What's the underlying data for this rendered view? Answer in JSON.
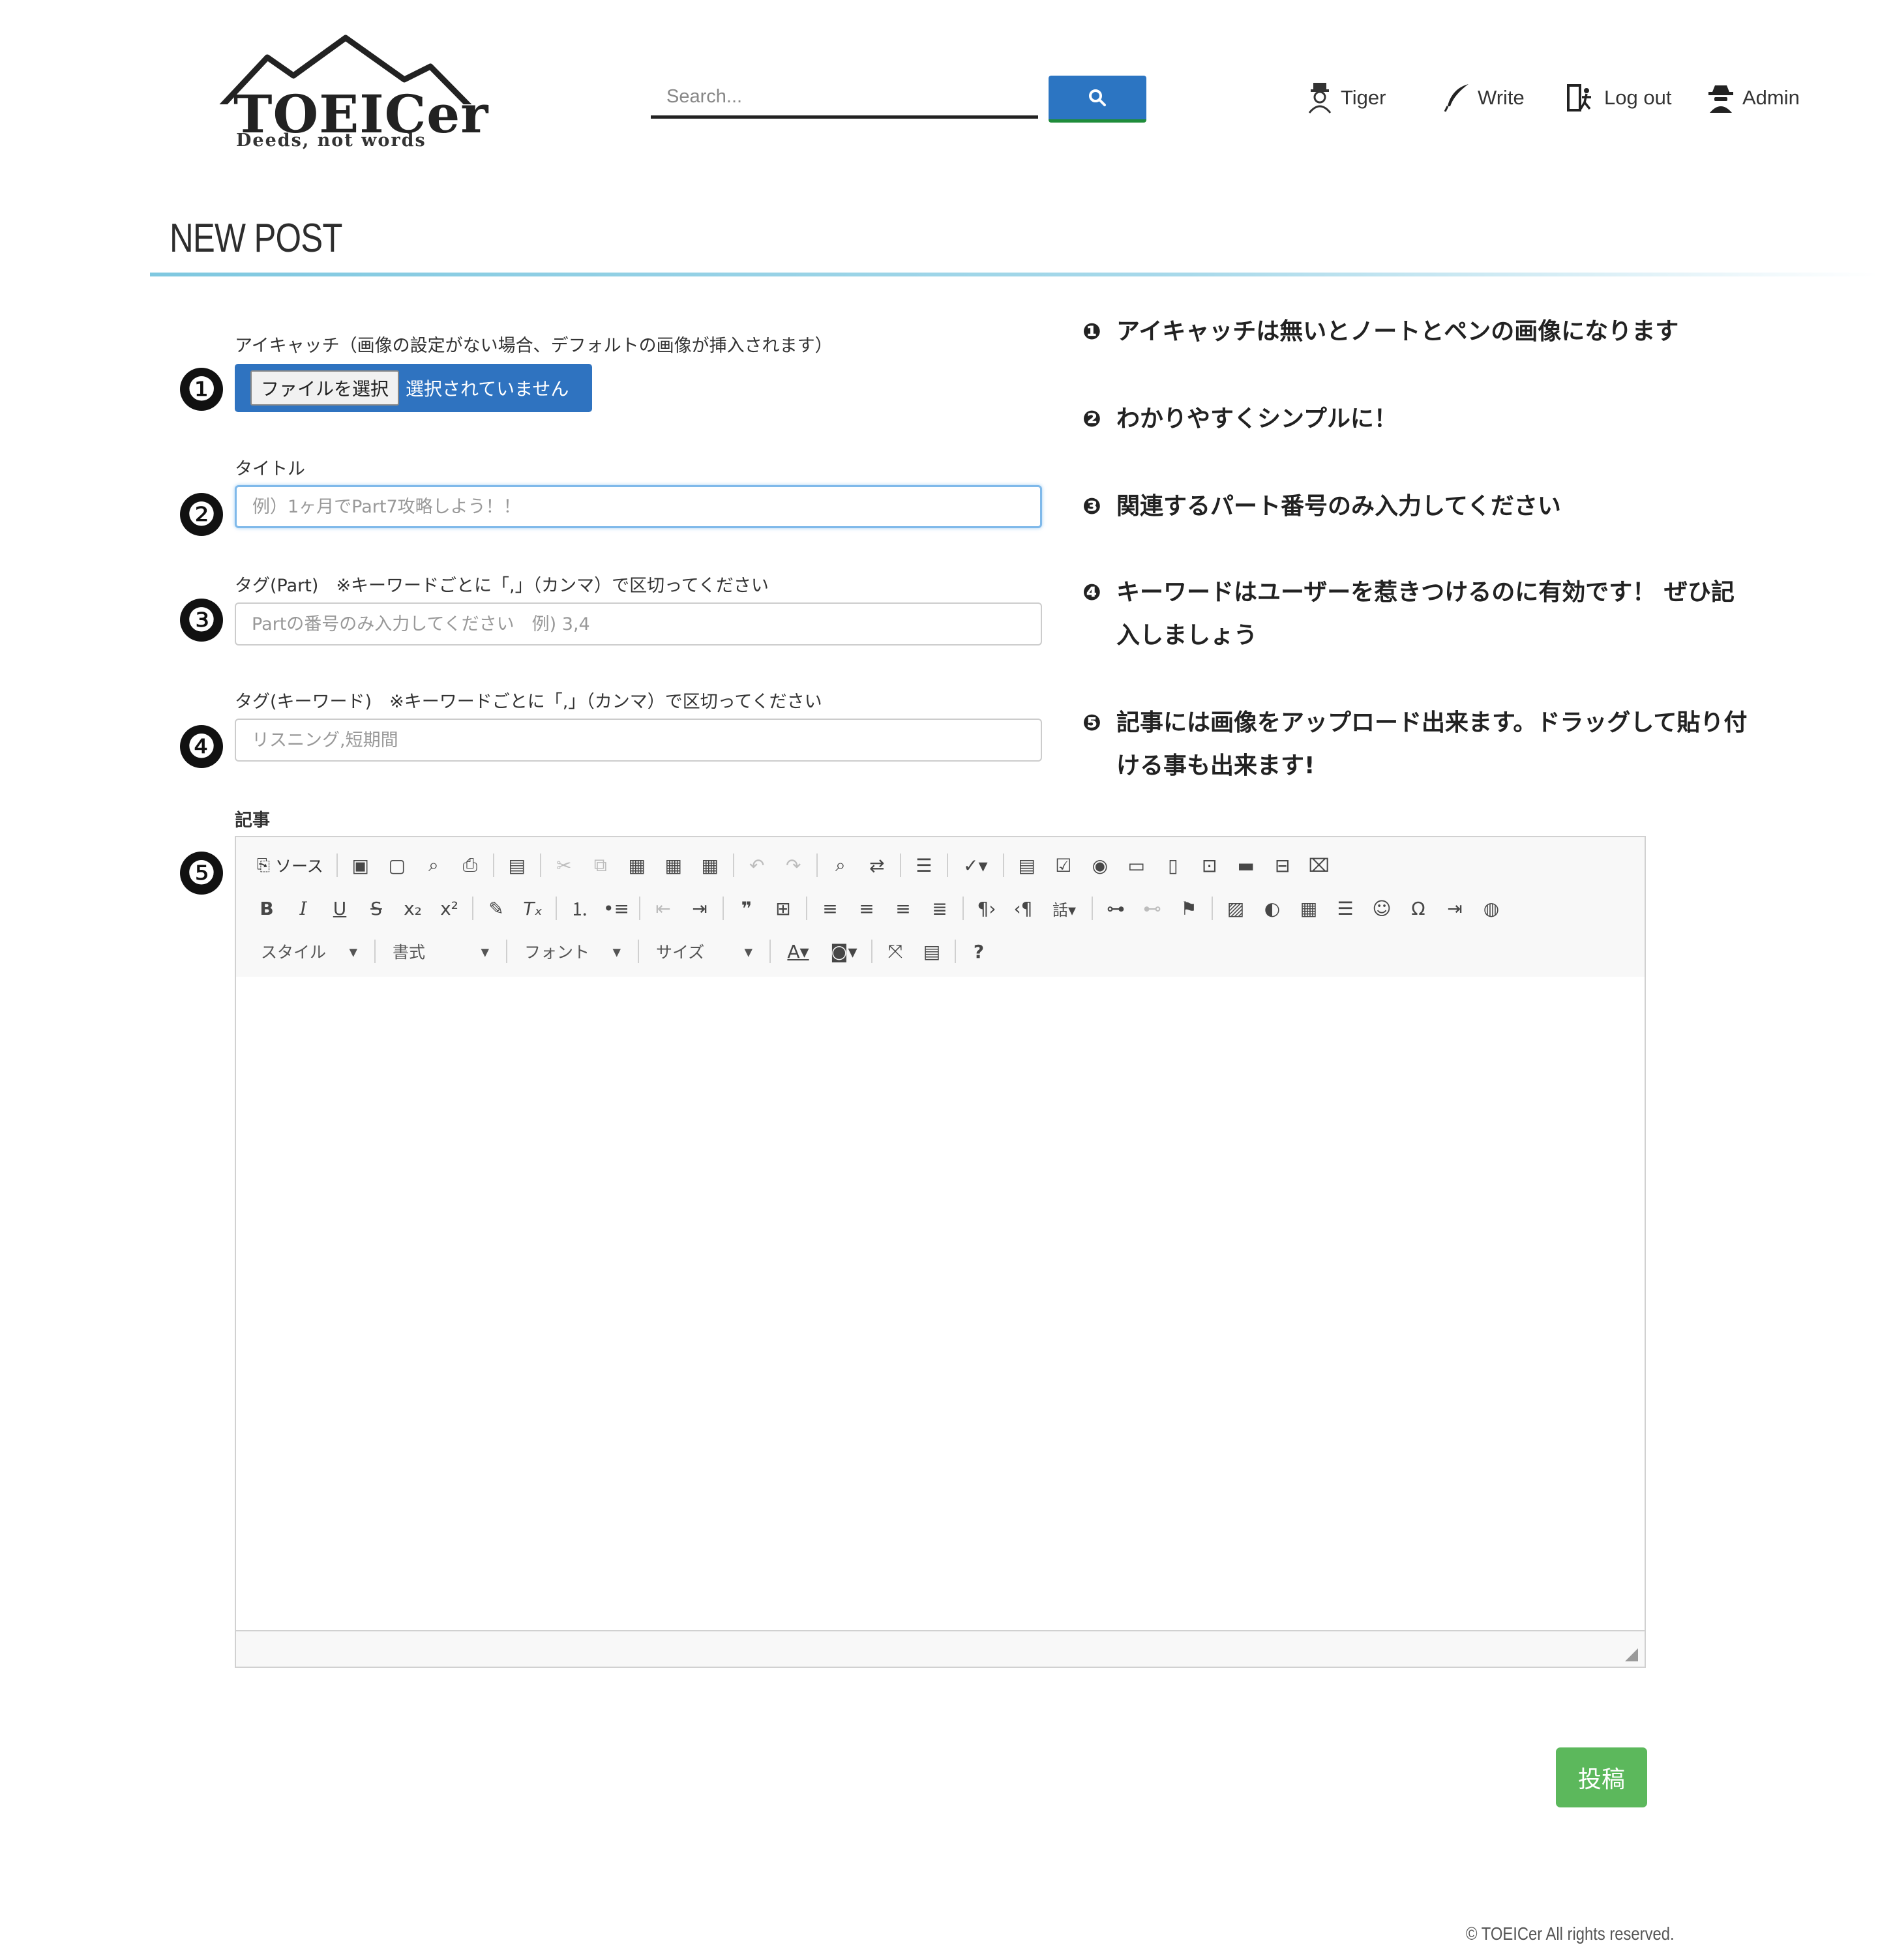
{
  "header": {
    "logo": {
      "name": "TOEICer",
      "tagline": "Deeds, not words"
    },
    "search": {
      "placeholder": "Search..."
    },
    "nav": [
      {
        "label": "Tiger",
        "icon": "user-avatar-icon"
      },
      {
        "label": "Write",
        "icon": "quill-pen-icon"
      },
      {
        "label": "Log out",
        "icon": "logout-door-icon"
      },
      {
        "label": "Admin",
        "icon": "admin-spy-icon"
      }
    ]
  },
  "page": {
    "title": "NEW POST"
  },
  "form": {
    "eyecatch": {
      "number": "❶",
      "label": "アイキャッチ（画像の設定がない場合、デフォルトの画像が挿入されます）",
      "button": "ファイルを選択",
      "status": "選択されていません"
    },
    "title": {
      "number": "❷",
      "label": "タイトル",
      "placeholder": "例）1ヶ月でPart7攻略しよう！！"
    },
    "tag_part": {
      "number": "❸",
      "label": "タグ(Part)　※キーワードごとに「,」（カンマ）で区切ってください",
      "placeholder": "Partの番号のみ入力してください　例) 3,4"
    },
    "tag_keyword": {
      "number": "❹",
      "label": "タグ(キーワード)　※キーワードごとに「,」（カンマ）で区切ってください",
      "placeholder": "リスニング,短期間"
    },
    "article": {
      "number": "❺",
      "label": "記事"
    },
    "submit": "投稿"
  },
  "editor": {
    "source_label": "ソース",
    "combos": [
      "スタイル",
      "書式",
      "フォント",
      "サイズ"
    ],
    "help": "?"
  },
  "hints": [
    {
      "num": "❶",
      "text": "アイキャッチは無いとノートとペンの画像になります"
    },
    {
      "num": "❷",
      "text": "わかりやすくシンプルに！"
    },
    {
      "num": "❸",
      "text": "関連するパート番号のみ入力してください"
    },
    {
      "num": "❹",
      "text": "キーワードはユーザーを惹きつけるのに有効です！ ぜひ記入しましょう"
    },
    {
      "num": "❺",
      "text": "記事には画像をアップロード出来ます。ドラッグして貼り付ける事も出来ます!"
    }
  ],
  "footer": {
    "copyright": "© TOEICer All rights reserved."
  },
  "colors": {
    "primary": "#2c75c2",
    "success": "#5cb85c",
    "accent_rule": "#7fc8e0"
  }
}
